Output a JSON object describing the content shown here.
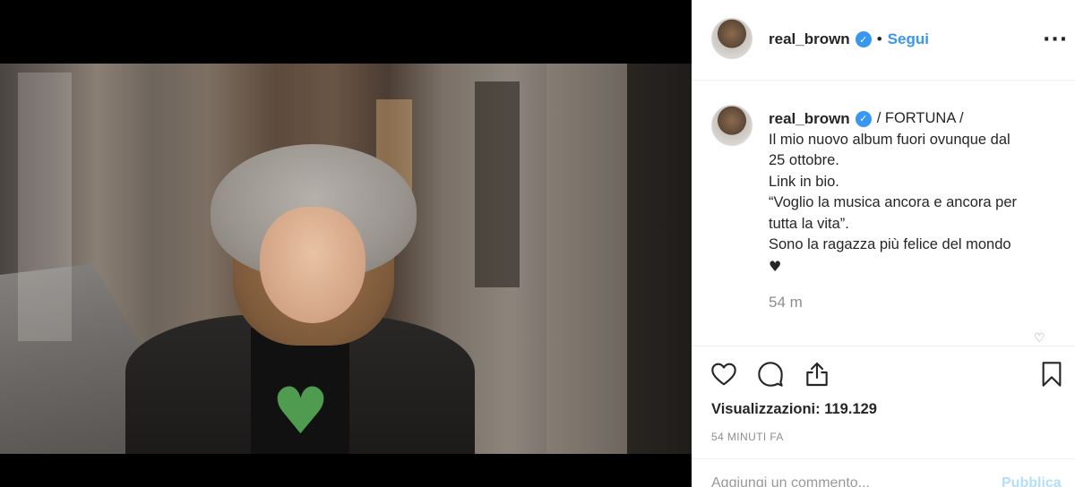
{
  "post": {
    "username": "real_brown",
    "verified_icon": "verified-badge-icon",
    "separator": "•",
    "follow_label": "Segui",
    "more_label": "···"
  },
  "caption": {
    "username": "real_brown",
    "title": "/ FORTUNA /",
    "lines": [
      "Il mio nuovo album fuori ovunque dal",
      "25 ottobre.",
      "Link in bio.",
      "“Voglio la musica ancora e ancora per",
      "tutta la vita”.",
      "Sono la ragazza più felice del mondo"
    ],
    "emoji": "♥",
    "time": "54 m"
  },
  "actions": {
    "like_icon": "heart-icon",
    "comment_icon": "comment-icon",
    "share_icon": "share-icon",
    "save_icon": "bookmark-icon"
  },
  "stats": {
    "views_label": "Visualizzazioni:",
    "views_count": "119.129",
    "posted": "54 MINUTI FA"
  },
  "comment": {
    "placeholder": "Aggiungi un commento...",
    "publish_label": "Pubblica"
  },
  "colors": {
    "accent": "#3897f0",
    "text": "#262626",
    "muted": "#8e8e8e",
    "divider": "#efefef"
  }
}
